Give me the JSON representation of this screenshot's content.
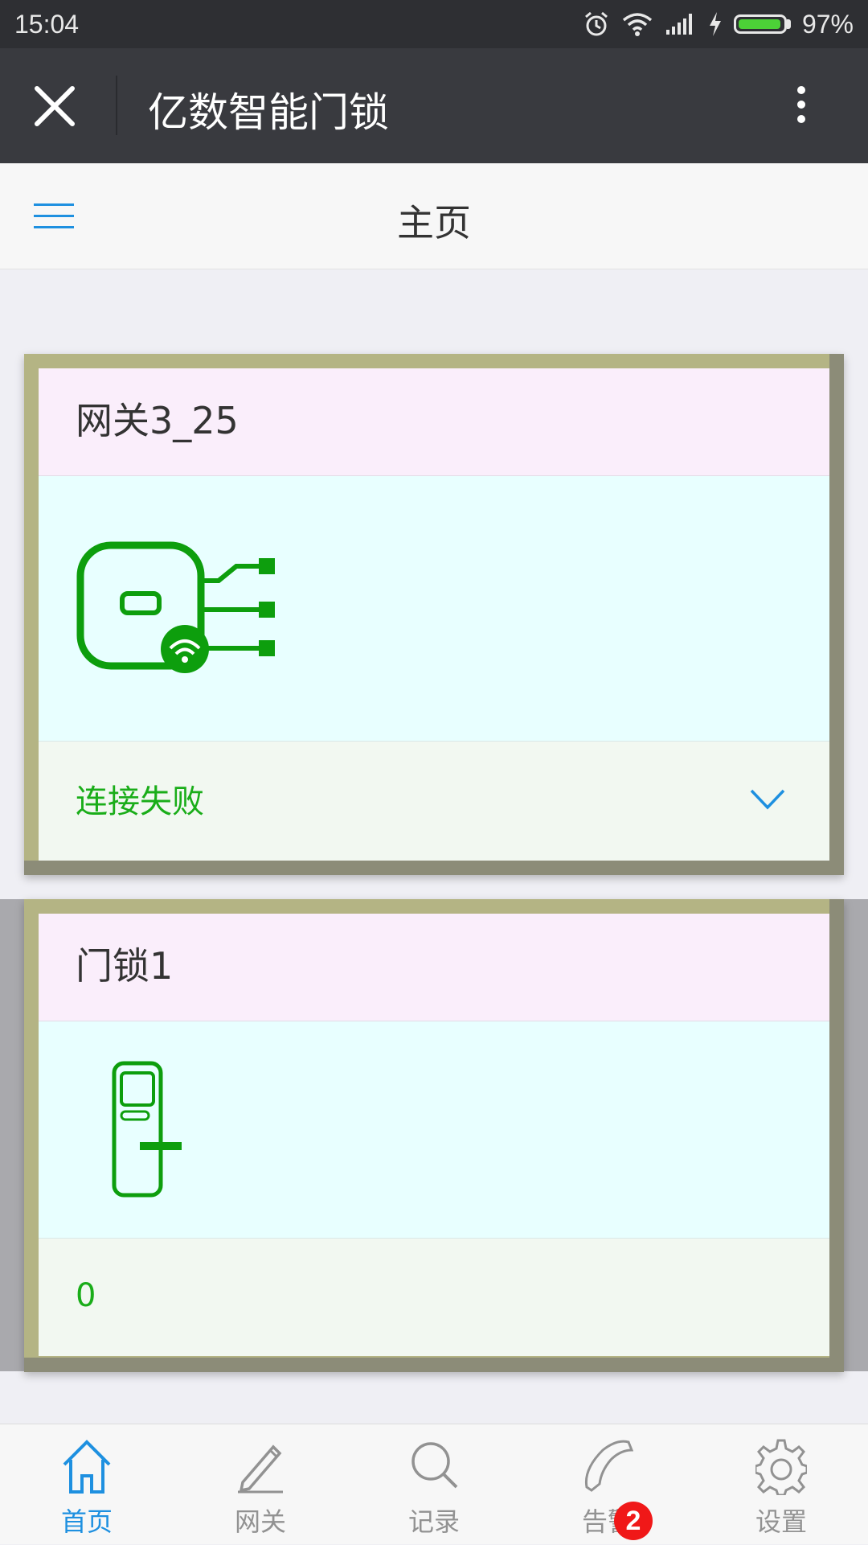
{
  "status_bar": {
    "time": "15:04",
    "battery_percent": "97%",
    "battery_level": 0.97
  },
  "app_bar": {
    "title": "亿数智能门锁",
    "close_icon": "close-icon",
    "more_icon": "more-vertical-icon"
  },
  "page_header": {
    "title": "主页",
    "menu_icon": "hamburger-menu-icon"
  },
  "devices": [
    {
      "name": "网关3_25",
      "icon": "gateway-icon",
      "status": "连接失败",
      "expand_icon": "chevron-down-icon"
    },
    {
      "name": "门锁1",
      "icon": "door-lock-icon",
      "status": "0"
    }
  ],
  "tabs": [
    {
      "label": "首页",
      "icon": "home-icon",
      "active": true
    },
    {
      "label": "网关",
      "icon": "pencil-icon",
      "active": false
    },
    {
      "label": "记录",
      "icon": "search-icon",
      "active": false
    },
    {
      "label": "告警",
      "icon": "phone-icon",
      "active": false,
      "badge": "2"
    },
    {
      "label": "设置",
      "icon": "gear-icon",
      "active": false
    }
  ],
  "colors": {
    "accent": "#1e90e0",
    "status_green": "#1aad19",
    "icon_green": "#0d9e0d",
    "badge_red": "#f01818"
  }
}
